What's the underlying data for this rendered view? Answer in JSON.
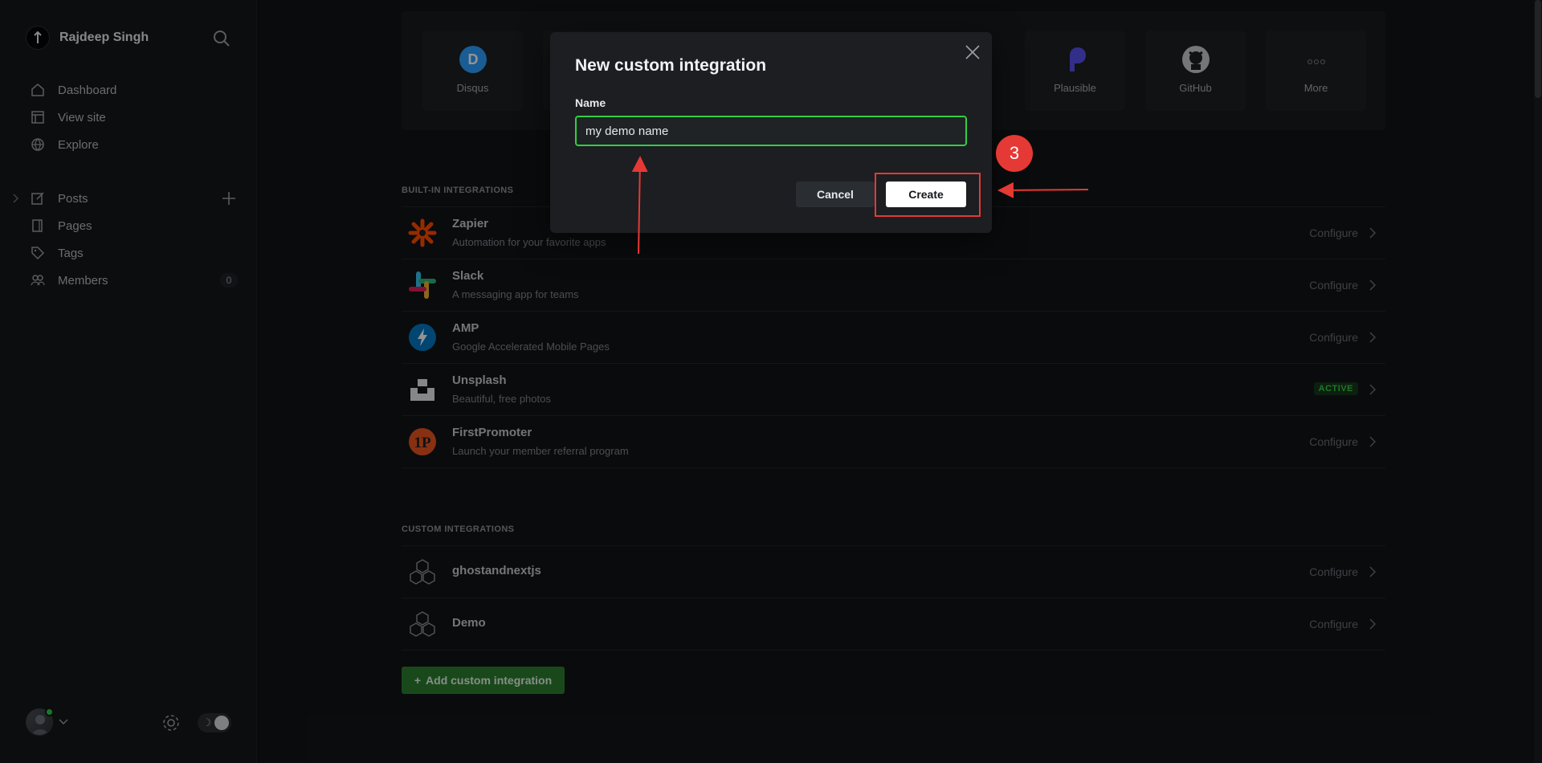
{
  "sidebar": {
    "user_name": "Rajdeep Singh",
    "nav": {
      "dashboard": "Dashboard",
      "view_site": "View site",
      "explore": "Explore",
      "posts": "Posts",
      "pages": "Pages",
      "tags": "Tags",
      "members": "Members",
      "members_count": "0"
    }
  },
  "apps": {
    "tiles": [
      "Disqus",
      "Plausible",
      "GitHub",
      "More"
    ]
  },
  "builtin": {
    "title": "BUILT-IN INTEGRATIONS",
    "items": [
      {
        "name": "Zapier",
        "desc": "Automation for your favorite apps",
        "action": "Configure"
      },
      {
        "name": "Slack",
        "desc": "A messaging app for teams",
        "action": "Configure"
      },
      {
        "name": "AMP",
        "desc": "Google Accelerated Mobile Pages",
        "action": "Configure"
      },
      {
        "name": "Unsplash",
        "desc": "Beautiful, free photos",
        "badge": "ACTIVE"
      },
      {
        "name": "FirstPromoter",
        "desc": "Launch your member referral program",
        "action": "Configure"
      }
    ]
  },
  "custom": {
    "title": "CUSTOM INTEGRATIONS",
    "items": [
      {
        "name": "ghostandnextjs",
        "action": "Configure"
      },
      {
        "name": "Demo",
        "action": "Configure"
      }
    ],
    "add_label": "Add custom integration"
  },
  "modal": {
    "title": "New custom integration",
    "field_label": "Name",
    "name_value": "my demo name",
    "cancel_label": "Cancel",
    "create_label": "Create"
  },
  "annotation": {
    "step": "3",
    "color": "#e53935"
  },
  "colors": {
    "accent_green": "#30cf43",
    "button_green": "#2b7f30"
  }
}
